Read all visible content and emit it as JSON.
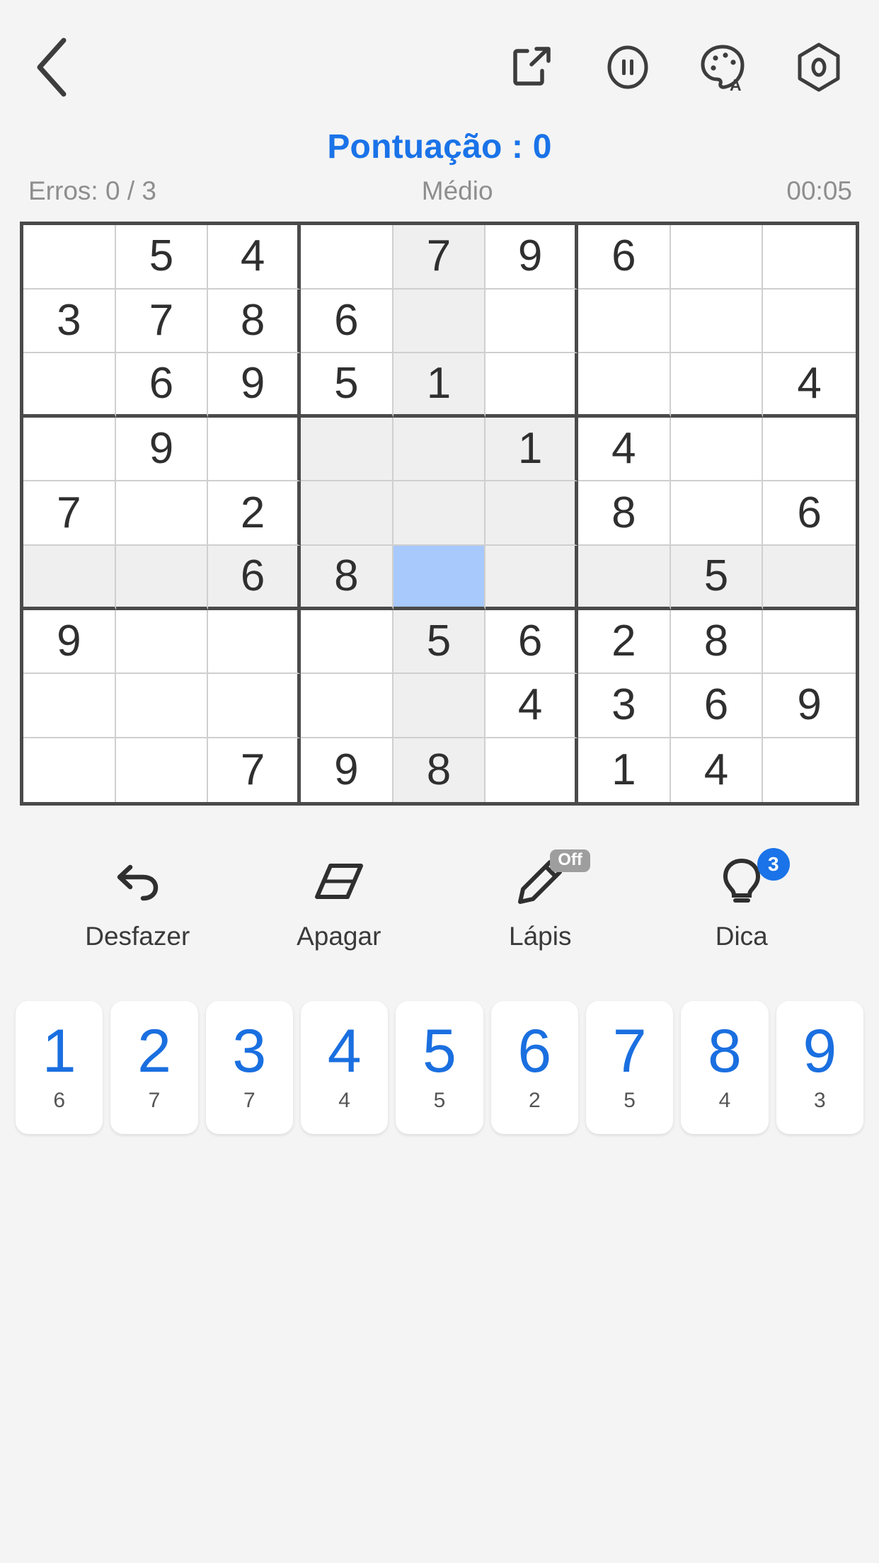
{
  "topbar": {
    "back_icon": "chevron-left-icon",
    "share_icon": "share-export-icon",
    "pause_icon": "pause-circle-icon",
    "theme_icon": "palette-auto-icon",
    "settings_icon": "settings-hexagon-icon"
  },
  "status": {
    "score": "Pontuação : 0",
    "errors": "Erros: 0 / 3",
    "difficulty": "Médio",
    "timer": "00:05"
  },
  "colors": {
    "accent": "#1a73e8",
    "selected_cell": "#a7c9fb",
    "highlight_cell": "#efefef",
    "grid_line": "#4a4a4a",
    "digit": "#2f2f2f"
  },
  "board": {
    "rows": [
      [
        "",
        "5",
        "4",
        "",
        "7",
        "9",
        "6",
        "",
        ""
      ],
      [
        "3",
        "7",
        "8",
        "6",
        "",
        "",
        "",
        "",
        ""
      ],
      [
        "",
        "6",
        "9",
        "5",
        "1",
        "",
        "",
        "",
        "4"
      ],
      [
        "",
        "9",
        "",
        "",
        "",
        "1",
        "4",
        "",
        ""
      ],
      [
        "7",
        "",
        "2",
        "",
        "",
        "",
        "8",
        "",
        "6"
      ],
      [
        "",
        "",
        "6",
        "8",
        "",
        "",
        "",
        "5",
        ""
      ],
      [
        "9",
        "",
        "",
        "",
        "5",
        "6",
        "2",
        "8",
        ""
      ],
      [
        "",
        "",
        "",
        "",
        "",
        "4",
        "3",
        "6",
        "9"
      ],
      [
        "",
        "",
        "7",
        "9",
        "8",
        "",
        "1",
        "4",
        ""
      ]
    ],
    "highlight": [
      [
        0,
        0,
        0,
        0,
        1,
        0,
        0,
        0,
        0
      ],
      [
        0,
        0,
        0,
        0,
        1,
        0,
        0,
        0,
        0
      ],
      [
        0,
        0,
        0,
        0,
        1,
        0,
        0,
        0,
        0
      ],
      [
        0,
        0,
        0,
        1,
        1,
        1,
        0,
        0,
        0
      ],
      [
        0,
        0,
        0,
        1,
        1,
        1,
        0,
        0,
        0
      ],
      [
        1,
        1,
        1,
        1,
        0,
        1,
        1,
        1,
        1
      ],
      [
        0,
        0,
        0,
        0,
        1,
        0,
        0,
        0,
        0
      ],
      [
        0,
        0,
        0,
        0,
        1,
        0,
        0,
        0,
        0
      ],
      [
        0,
        0,
        0,
        0,
        1,
        0,
        0,
        0,
        0
      ]
    ],
    "selected": {
      "row": 6,
      "col": 5
    }
  },
  "actions": [
    {
      "name": "undo",
      "icon": "undo-arrow-icon",
      "label": "Desfazer",
      "badge": ""
    },
    {
      "name": "erase",
      "icon": "eraser-icon",
      "label": "Apagar",
      "badge": ""
    },
    {
      "name": "pencil",
      "icon": "pencil-icon",
      "label": "Lápis",
      "badge": "Off"
    },
    {
      "name": "hint",
      "icon": "lightbulb-icon",
      "label": "Dica",
      "badge": "3"
    }
  ],
  "numpad": [
    {
      "digit": "1",
      "count": "6"
    },
    {
      "digit": "2",
      "count": "7"
    },
    {
      "digit": "3",
      "count": "7"
    },
    {
      "digit": "4",
      "count": "4"
    },
    {
      "digit": "5",
      "count": "5"
    },
    {
      "digit": "6",
      "count": "2"
    },
    {
      "digit": "7",
      "count": "5"
    },
    {
      "digit": "8",
      "count": "4"
    },
    {
      "digit": "9",
      "count": "3"
    }
  ]
}
